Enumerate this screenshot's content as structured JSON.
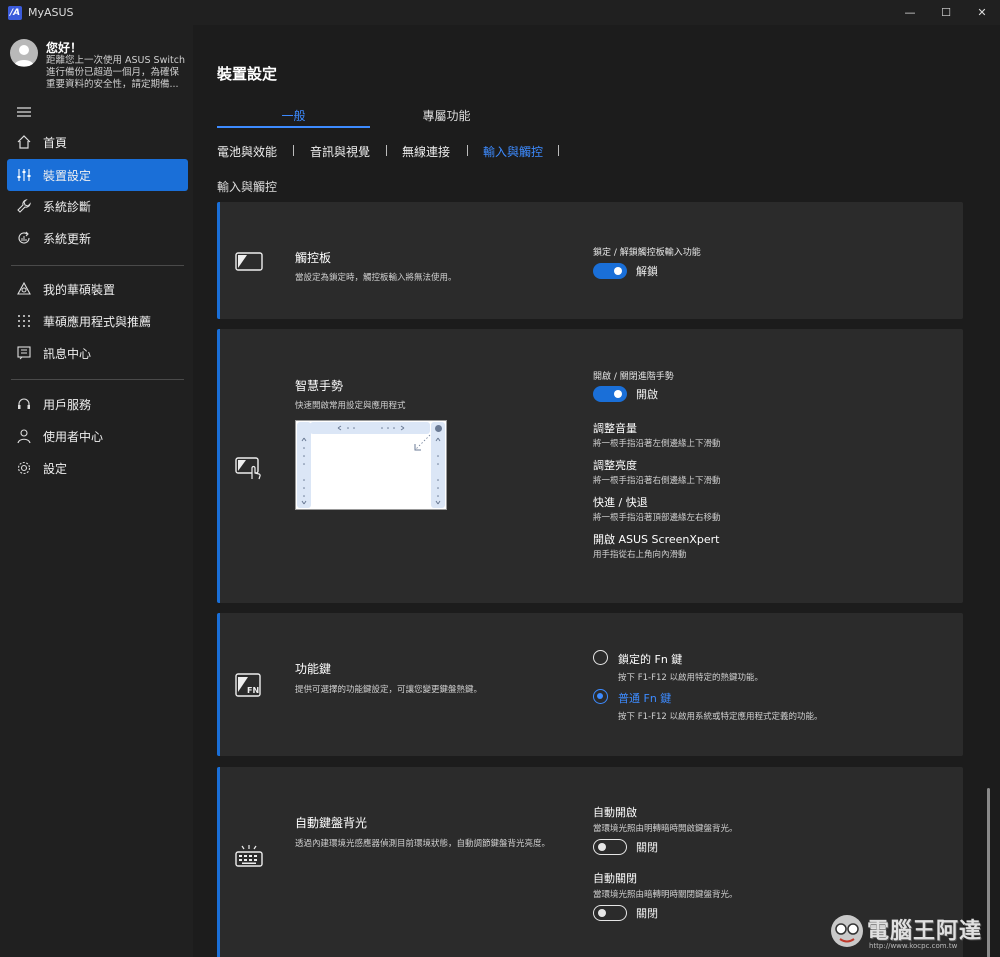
{
  "window": {
    "title": "MyASUS",
    "logo_text": "/A",
    "minimize": "—",
    "maximize": "☐",
    "close": "✕"
  },
  "user": {
    "greeting": "您好！",
    "message": "距離您上一次使用 ASUS Switch 進行備份已超過一個月，為確保重要資料的安全性，請定期備..."
  },
  "sidebar": {
    "items": [
      {
        "label": "首頁",
        "icon": "home-icon"
      },
      {
        "label": "裝置設定",
        "icon": "sliders-icon",
        "active": true
      },
      {
        "label": "系統診斷",
        "icon": "wrench-icon"
      },
      {
        "label": "系統更新",
        "icon": "update-icon"
      },
      {
        "label": "我的華碩裝置",
        "icon": "triangle-icon"
      },
      {
        "label": "華碩應用程式與推薦",
        "icon": "grid-icon"
      },
      {
        "label": "訊息中心",
        "icon": "message-icon"
      },
      {
        "label": "用戶服務",
        "icon": "headset-icon"
      },
      {
        "label": "使用者中心",
        "icon": "user-icon"
      },
      {
        "label": "設定",
        "icon": "gear-icon"
      }
    ]
  },
  "main": {
    "title": "裝置設定",
    "tabs": [
      {
        "label": "一般",
        "active": true
      },
      {
        "label": "專屬功能"
      }
    ],
    "subtabs": [
      "電池與效能",
      "音訊與視覺",
      "無線連接",
      "輸入與觸控"
    ],
    "section": "輸入與觸控"
  },
  "cards": {
    "touchpad": {
      "title": "觸控板",
      "desc": "當設定為鎖定時，觸控板輸入將無法使用。",
      "option_label": "鎖定 / 解鎖觸控板輸入功能",
      "toggle_state": "on",
      "toggle_text": "解鎖"
    },
    "gestures": {
      "title": "智慧手勢",
      "desc": "快速開啟常用設定與應用程式",
      "option_label": "開啟 / 關閉進階手勢",
      "toggle_state": "on",
      "toggle_text": "開啟",
      "items": [
        {
          "title": "調整音量",
          "desc": "將一根手指沿著左側邊緣上下滑動"
        },
        {
          "title": "調整亮度",
          "desc": "將一根手指沿著右側邊緣上下滑動"
        },
        {
          "title": "快進 / 快退",
          "desc": "將一根手指沿著頂部邊緣左右移動"
        },
        {
          "title": "開啟 ASUS ScreenXpert",
          "desc": "用手指從右上角向內滑動"
        }
      ]
    },
    "fnkey": {
      "title": "功能鍵",
      "desc": "提供可選擇的功能鍵設定，可讓您變更鍵盤熱鍵。",
      "options": [
        {
          "title": "鎖定的 Fn 鍵",
          "desc": "按下 F1-F12 以啟用特定的熱鍵功能。",
          "selected": false
        },
        {
          "title": "普通 Fn 鍵",
          "desc": "按下 F1-F12 以啟用系統或特定應用程式定義的功能。",
          "selected": true
        }
      ]
    },
    "backlight": {
      "title": "自動鍵盤背光",
      "desc": "透過內建環境光感應器偵測目前環境狀態，自動調節鍵盤背光亮度。",
      "auto_on": {
        "title": "自動開啟",
        "desc": "當環境光照由明轉暗時開啟鍵盤背光。",
        "toggle_state": "off",
        "toggle_text": "關閉"
      },
      "auto_off": {
        "title": "自動關閉",
        "desc": "當環境光照由暗轉明時關閉鍵盤背光。",
        "toggle_state": "off",
        "toggle_text": "關閉"
      }
    }
  },
  "watermark": {
    "text": "電腦王阿達",
    "url": "http://www.kocpc.com.tw"
  },
  "colors": {
    "accent": "#1a6fd8",
    "link": "#3d8bff",
    "bg": "#1c1c1c",
    "card": "#2b2b2b"
  }
}
